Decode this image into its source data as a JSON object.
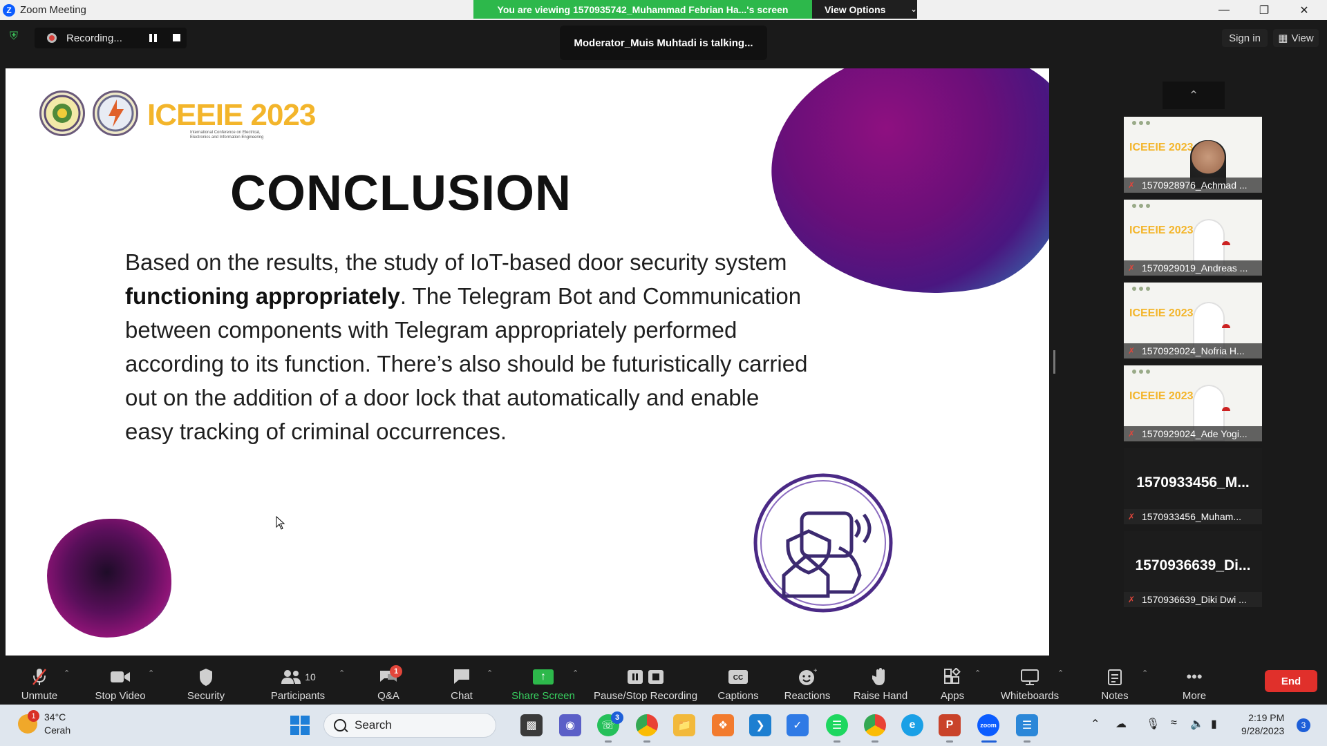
{
  "window": {
    "title": "Zoom Meeting",
    "viewing_banner": "You are viewing 1570935742_Muhammad Febrian Ha...'s screen",
    "view_options": "View Options",
    "controls": [
      "minimize-icon",
      "restore-icon",
      "close-icon"
    ]
  },
  "topbar": {
    "recording_label": "Recording...",
    "talking": "Moderator_Muis Muhtadi is talking...",
    "sign_in": "Sign in",
    "view": "View"
  },
  "slide": {
    "brand": "ICEEIE 2023",
    "brand_sub": "International Conference on Electrical, Electronics and Information Engineering",
    "title": "CONCLUSION",
    "body_part1": "Based on the results, the study of IoT-based door security system ",
    "body_bold": "functioning appropriately",
    "body_part2": ". The Telegram Bot and Communication between components with Telegram appropriately performed according to its function. There’s also should be futuristically carried out on the addition of a door lock that automatically and enable easy tracking of criminal occurrences."
  },
  "participants_panel": {
    "tiles": [
      {
        "type": "video-face",
        "name": "1570928976_Achmad ..."
      },
      {
        "type": "video",
        "name": "1570929019_Andreas ..."
      },
      {
        "type": "video",
        "name": "1570929024_Nofria H..."
      },
      {
        "type": "video",
        "name": "1570929024_Ade Yogi..."
      },
      {
        "type": "no-video",
        "big_name": "1570933456_M...",
        "name": "1570933456_Muham..."
      },
      {
        "type": "no-video",
        "big_name": "1570936639_Di...",
        "name": "1570936639_Diki Dwi ..."
      }
    ]
  },
  "toolbar": {
    "unmute": "Unmute",
    "stop_video": "Stop Video",
    "security": "Security",
    "participants": "Participants",
    "participants_count": "10",
    "qa": "Q&A",
    "qa_badge": "1",
    "chat": "Chat",
    "share_screen": "Share Screen",
    "pause_stop_recording": "Pause/Stop Recording",
    "captions": "Captions",
    "reactions": "Reactions",
    "raise_hand": "Raise Hand",
    "apps": "Apps",
    "whiteboards": "Whiteboards",
    "notes": "Notes",
    "more": "More",
    "end": "End"
  },
  "taskbar": {
    "weather_badge": "1",
    "temperature": "34°C",
    "condition": "Cerah",
    "search_placeholder": "Search",
    "whatsapp_badge": "3",
    "time": "2:19 PM",
    "date": "9/28/2023",
    "notification_count": "3"
  }
}
